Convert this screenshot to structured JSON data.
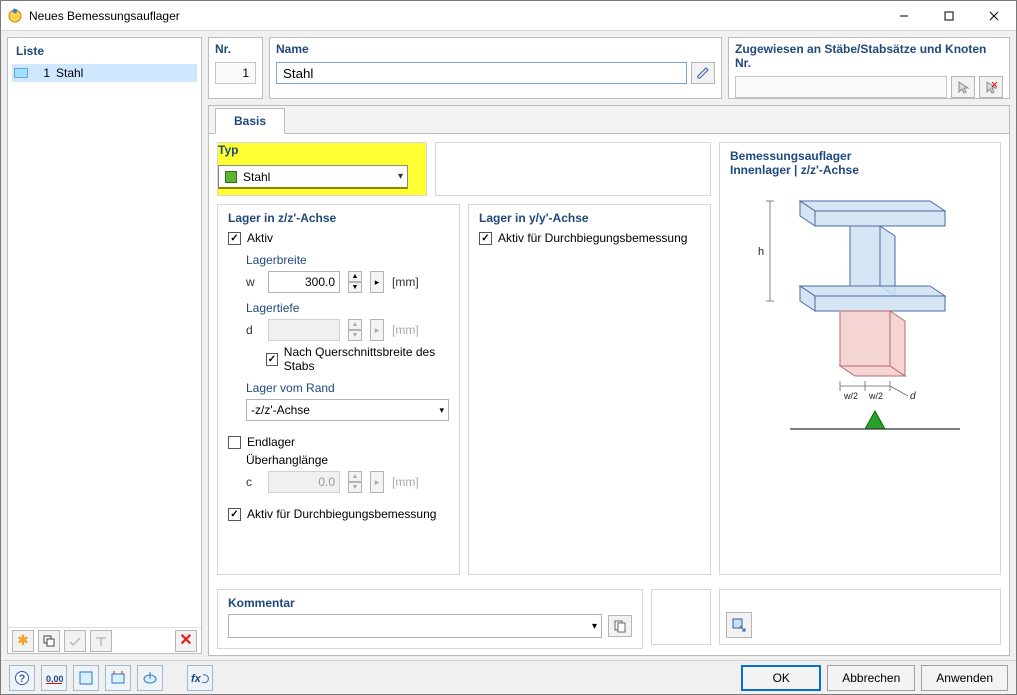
{
  "window": {
    "title": "Neues Bemessungsauflager"
  },
  "list": {
    "label": "Liste",
    "items": [
      {
        "num": "1",
        "name": "Stahl"
      }
    ],
    "toolbar_delete_title": "Löschen"
  },
  "nr": {
    "label": "Nr.",
    "value": "1"
  },
  "name": {
    "label": "Name",
    "value": "Stahl"
  },
  "assign": {
    "label": "Zugewiesen an Stäbe/Stabsätze und Knoten Nr.",
    "value": ""
  },
  "tabs": {
    "basis": "Basis"
  },
  "typ": {
    "label": "Typ",
    "value": "Stahl"
  },
  "z": {
    "group": "Lager in z/z'-Achse",
    "aktiv": "Aktiv",
    "lagerbreite": "Lagerbreite",
    "w_sym": "w",
    "w_value": "300.0",
    "w_unit": "[mm]",
    "lagertiefe": "Lagertiefe",
    "d_sym": "d",
    "d_value": "",
    "d_unit": "[mm]",
    "nach_querschnitt": "Nach Querschnittsbreite des Stabs",
    "lager_vom_rand": "Lager vom Rand",
    "rand_value": "-z/z'-Achse",
    "endlager": "Endlager",
    "uberhang": "Überhanglänge",
    "c_sym": "c",
    "c_value": "0.0",
    "c_unit": "[mm]",
    "aktiv_durch": "Aktiv für Durchbiegungsbemessung"
  },
  "y": {
    "group": "Lager in y/y'-Achse",
    "aktiv_durch": "Aktiv für Durchbiegungsbemessung"
  },
  "preview": {
    "t1": "Bemessungsauflager",
    "t2": "Innenlager | z/z'-Achse",
    "h_label": "h",
    "w2a": "w/2",
    "w2b": "w/2",
    "d_label": "d"
  },
  "comment": {
    "label": "Kommentar",
    "value": ""
  },
  "buttons": {
    "ok": "OK",
    "cancel": "Abbrechen",
    "apply": "Anwenden"
  }
}
